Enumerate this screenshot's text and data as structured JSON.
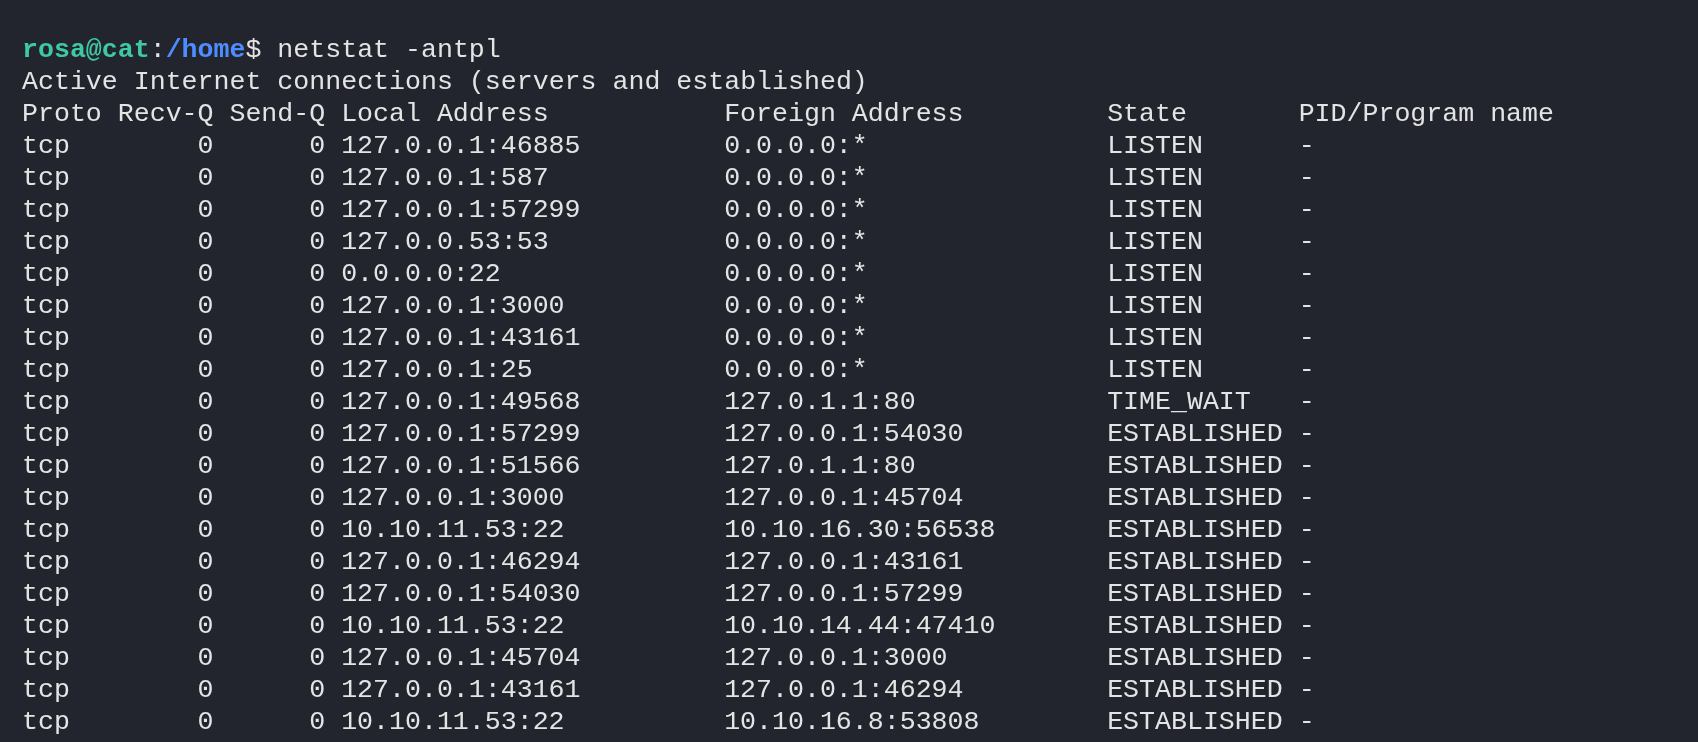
{
  "prompt": {
    "user_host": "rosa@cat",
    "separator": ":",
    "path": "/home",
    "symbol": "$",
    "command": "netstat -antpl"
  },
  "banner": "Active Internet connections (servers and established)",
  "columns": [
    "Proto",
    "Recv-Q",
    "Send-Q",
    "Local Address",
    "Foreign Address",
    "State",
    "PID/Program name"
  ],
  "rows": [
    [
      "tcp",
      "0",
      "0",
      "127.0.0.1:46885",
      "0.0.0.0:*",
      "LISTEN",
      "-"
    ],
    [
      "tcp",
      "0",
      "0",
      "127.0.0.1:587",
      "0.0.0.0:*",
      "LISTEN",
      "-"
    ],
    [
      "tcp",
      "0",
      "0",
      "127.0.0.1:57299",
      "0.0.0.0:*",
      "LISTEN",
      "-"
    ],
    [
      "tcp",
      "0",
      "0",
      "127.0.0.53:53",
      "0.0.0.0:*",
      "LISTEN",
      "-"
    ],
    [
      "tcp",
      "0",
      "0",
      "0.0.0.0:22",
      "0.0.0.0:*",
      "LISTEN",
      "-"
    ],
    [
      "tcp",
      "0",
      "0",
      "127.0.0.1:3000",
      "0.0.0.0:*",
      "LISTEN",
      "-"
    ],
    [
      "tcp",
      "0",
      "0",
      "127.0.0.1:43161",
      "0.0.0.0:*",
      "LISTEN",
      "-"
    ],
    [
      "tcp",
      "0",
      "0",
      "127.0.0.1:25",
      "0.0.0.0:*",
      "LISTEN",
      "-"
    ],
    [
      "tcp",
      "0",
      "0",
      "127.0.0.1:49568",
      "127.0.1.1:80",
      "TIME_WAIT",
      "-"
    ],
    [
      "tcp",
      "0",
      "0",
      "127.0.0.1:57299",
      "127.0.0.1:54030",
      "ESTABLISHED",
      "-"
    ],
    [
      "tcp",
      "0",
      "0",
      "127.0.0.1:51566",
      "127.0.1.1:80",
      "ESTABLISHED",
      "-"
    ],
    [
      "tcp",
      "0",
      "0",
      "127.0.0.1:3000",
      "127.0.0.1:45704",
      "ESTABLISHED",
      "-"
    ],
    [
      "tcp",
      "0",
      "0",
      "10.10.11.53:22",
      "10.10.16.30:56538",
      "ESTABLISHED",
      "-"
    ],
    [
      "tcp",
      "0",
      "0",
      "127.0.0.1:46294",
      "127.0.0.1:43161",
      "ESTABLISHED",
      "-"
    ],
    [
      "tcp",
      "0",
      "0",
      "127.0.0.1:54030",
      "127.0.0.1:57299",
      "ESTABLISHED",
      "-"
    ],
    [
      "tcp",
      "0",
      "0",
      "10.10.11.53:22",
      "10.10.14.44:47410",
      "ESTABLISHED",
      "-"
    ],
    [
      "tcp",
      "0",
      "0",
      "127.0.0.1:45704",
      "127.0.0.1:3000",
      "ESTABLISHED",
      "-"
    ],
    [
      "tcp",
      "0",
      "0",
      "127.0.0.1:43161",
      "127.0.0.1:46294",
      "ESTABLISHED",
      "-"
    ],
    [
      "tcp",
      "0",
      "0",
      "10.10.11.53:22",
      "10.10.16.8:53808",
      "ESTABLISHED",
      "-"
    ]
  ]
}
